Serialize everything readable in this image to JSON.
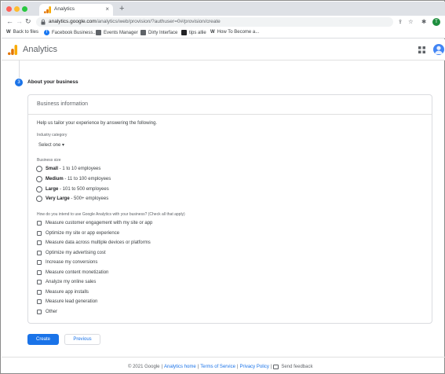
{
  "browser": {
    "tab_title": "Analytics",
    "tab_close": "×",
    "new_tab": "+",
    "url_host": "analytics.google.com",
    "url_path": "/analytics/web/provision/?authuser=0#/provision/create",
    "profile_initial": "T",
    "nav": {
      "back": "←",
      "forward": "→",
      "reload": "↻"
    },
    "bookmarks": [
      {
        "label": "Back to files",
        "icon": "W",
        "color": "#3c4043"
      },
      {
        "label": "Facebook Business...",
        "icon": "f",
        "color": "#1877f2"
      },
      {
        "label": "Events Manager",
        "icon": "▦",
        "color": "#5f6368"
      },
      {
        "label": "Dirty Interface",
        "icon": "▤",
        "color": "#5f6368"
      },
      {
        "label": "tips allie",
        "icon": "■",
        "color": "#202124"
      },
      {
        "label": "How To Become a...",
        "icon": "W",
        "color": "#3c4043"
      }
    ]
  },
  "header": {
    "product": "Analytics"
  },
  "step": {
    "number": "3",
    "title": "About your business"
  },
  "card": {
    "title": "Business information",
    "help": "Help us tailor your experience by answering the following.",
    "industry_label": "Industry category",
    "industry_value": "Select one ▾",
    "size_label": "Business size",
    "sizes": [
      {
        "bold": "Small",
        "rest": " - 1 to 10 employees"
      },
      {
        "bold": "Medium",
        "rest": " - 11 to 100 employees"
      },
      {
        "bold": "Large",
        "rest": " - 101 to 500 employees"
      },
      {
        "bold": "Very Large",
        "rest": " - 500+ employees"
      }
    ],
    "usage_label": "How do you intend to use Google Analytics with your business? (Check all that apply)",
    "usage": [
      "Measure customer engagement with my site or app",
      "Optimize my site or app experience",
      "Measure data across multiple devices or platforms",
      "Optimize my advertising cost",
      "Increase my conversions",
      "Measure content monetization",
      "Analyze my online sales",
      "Measure app installs",
      "Measure lead generation",
      "Other"
    ]
  },
  "actions": {
    "create": "Create",
    "previous": "Previous"
  },
  "footer": {
    "copyright": "© 2021 Google",
    "analytics_home": "Analytics home",
    "terms": "Terms of Service",
    "privacy": "Privacy Policy",
    "feedback": "Send feedback",
    "sep": "|"
  }
}
